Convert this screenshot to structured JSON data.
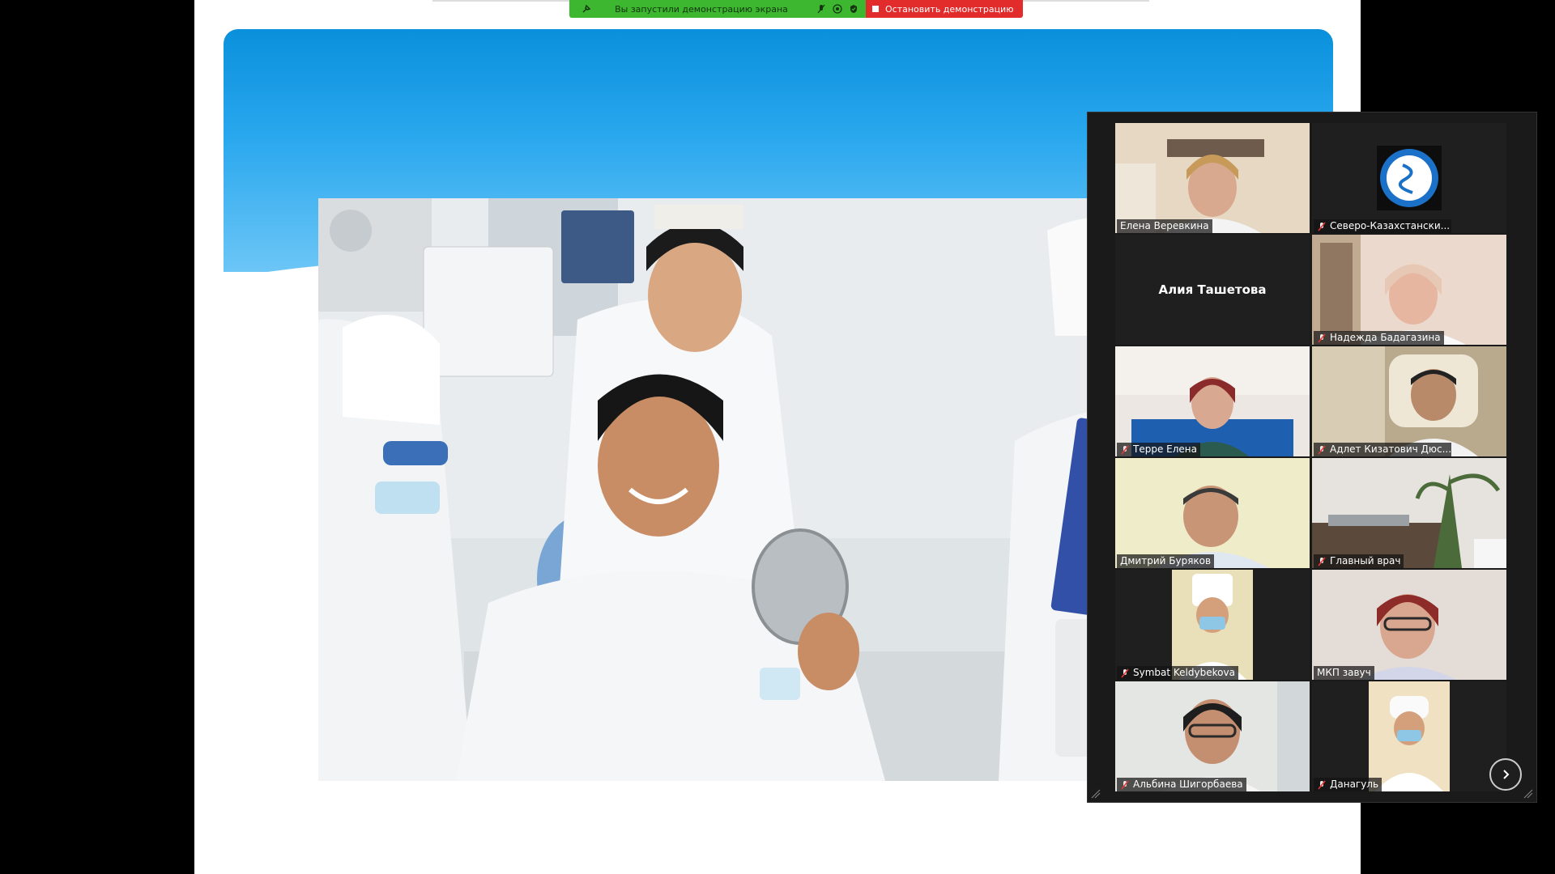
{
  "share_toolbar": {
    "status_text": "Вы запустили демонстрацию экрана",
    "stop_label": "Остановить демонстрацию",
    "green_color": "#3cb72f",
    "red_color": "#e22b2b"
  },
  "gallery": {
    "participants": [
      {
        "name": "Елена Веревкина",
        "muted": false,
        "video": "person-office-wall"
      },
      {
        "name": "Северо-Казахстански...",
        "muted": true,
        "video": "logo"
      },
      {
        "name": "Алия Ташетова",
        "muted": false,
        "video": "none"
      },
      {
        "name": "Надежда Бадагазина",
        "muted": true,
        "video": "person-office-shelf"
      },
      {
        "name": "Терре Елена",
        "muted": true,
        "video": "person-office-blue"
      },
      {
        "name": "Адлет Кизатович Дюс...",
        "muted": true,
        "video": "person-office-chair"
      },
      {
        "name": "Дмитрий Буряков",
        "muted": false,
        "video": "person-bright",
        "active_speaker": true
      },
      {
        "name": "Главный врач",
        "muted": true,
        "video": "office-plant"
      },
      {
        "name": "Symbat Keldybekova",
        "muted": true,
        "video": "person-medical-cap"
      },
      {
        "name": "МКП завуч",
        "muted": false,
        "video": "person-glasses"
      },
      {
        "name": "Альбина Шигорбаева",
        "muted": true,
        "video": "person-glasses-2"
      },
      {
        "name": "Данагуль",
        "muted": true,
        "video": "person-medical-cap-2"
      }
    ],
    "next_icon": "chevron-right-icon",
    "active_outline_color": "#c8d93a"
  }
}
